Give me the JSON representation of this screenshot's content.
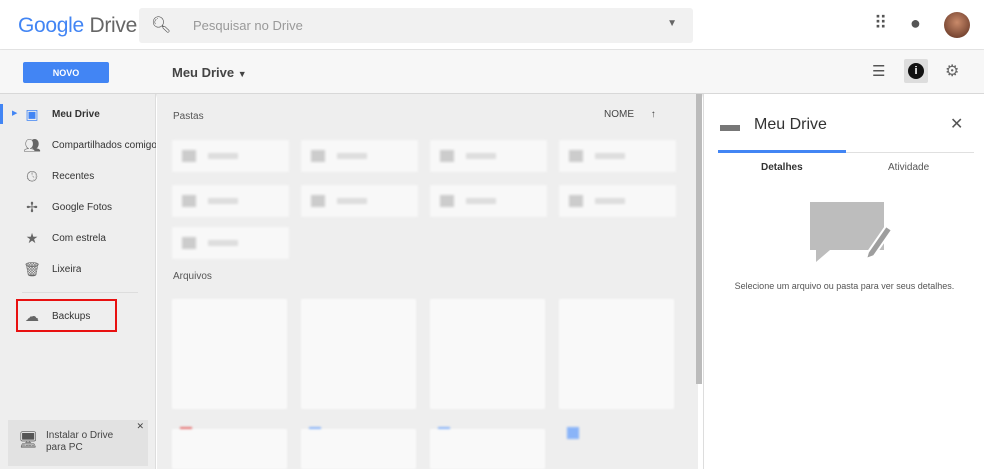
{
  "header": {
    "logo_google": "Google",
    "logo_drive": "Drive",
    "search_placeholder": "Pesquisar no Drive"
  },
  "toolbar": {
    "new_label": "NOVO",
    "breadcrumb": "Meu Drive"
  },
  "sidebar": {
    "items": [
      {
        "label": "Meu Drive",
        "icon": "drive-icon"
      },
      {
        "label": "Compartilhados comigo",
        "icon": "people-icon"
      },
      {
        "label": "Recentes",
        "icon": "clock-icon"
      },
      {
        "label": "Google Fotos",
        "icon": "photos-icon"
      },
      {
        "label": "Com estrela",
        "icon": "star-icon"
      },
      {
        "label": "Lixeira",
        "icon": "trash-icon"
      }
    ],
    "backups": "Backups",
    "install": "Instalar o Drive para PC"
  },
  "main": {
    "folders_label": "Pastas",
    "files_label": "Arquivos",
    "sort_label": "NOME"
  },
  "panel": {
    "title": "Meu Drive",
    "tabs": [
      "Detalhes",
      "Atividade"
    ],
    "message": "Selecione um arquivo ou pasta para ver seus detalhes."
  },
  "colors": {
    "accent": "#4285f4",
    "highlight": "#e81010"
  }
}
